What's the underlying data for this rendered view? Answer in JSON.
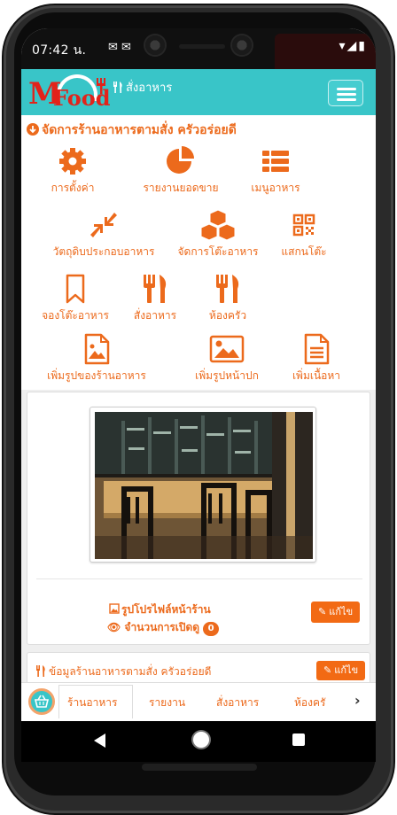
{
  "status_bar": {
    "time": "07:42 น.",
    "left_icons": "✉ ✉",
    "right_icons": "▾◢▮"
  },
  "header": {
    "logo_m": "M",
    "logo_food": "Food",
    "title": "สั่งอาหาร",
    "title_icon": "fork-knife-icon",
    "menu_icon": "hamburger-menu-icon"
  },
  "menu": {
    "heading": "จัดการร้านอาหารตามสั่ง ครัวอร่อยดี",
    "heading_icon": "circle-arrow-down-icon",
    "items": [
      {
        "label": "การตั้งค่า",
        "icon": "gear-icon"
      },
      {
        "label": "รายงานยอดขาย",
        "icon": "pie-chart-icon"
      },
      {
        "label": "เมนูอาหาร",
        "icon": "list-icon"
      },
      {
        "label": "วัตถุดิบประกอบอาหาร",
        "icon": "compress-arrows-icon"
      },
      {
        "label": "จัดการโต๊ะอาหาร",
        "icon": "cubes-icon"
      },
      {
        "label": "แสกนโต๊ะ",
        "icon": "qr-code-icon"
      },
      {
        "label": "จองโต๊ะอาหาร",
        "icon": "bookmark-icon"
      },
      {
        "label": "สั่งอาหาร",
        "icon": "fork-knife-icon"
      },
      {
        "label": "ห้องครัว",
        "icon": "fork-knife-icon"
      },
      {
        "label": "เพิ่มรูปของร้านอาหาร",
        "icon": "image-file-icon"
      },
      {
        "label": "เพิ่มรูปหน้าปก",
        "icon": "image-icon"
      },
      {
        "label": "เพิ่มเนื้อหา",
        "icon": "text-file-icon"
      }
    ]
  },
  "profile_card": {
    "photo_alt": "restaurant-interior-photo",
    "profile_label": "รูปโปรไฟล์หน้าร้าน",
    "views_label": "จำนวนการเปิดดู",
    "views_count": "0",
    "edit_label": "แก้ไข"
  },
  "info_card": {
    "title": "ข้อมูลร้านอาหารตามสั่ง ครัวอร่อยดี",
    "edit_label": "แก้ไข"
  },
  "tabs": {
    "items": [
      "ร้านอาหาร",
      "รายงาน",
      "สั่งอาหาร",
      "ห้องครั"
    ],
    "next_icon": "chevron-right-icon"
  },
  "colors": {
    "primary": "#39c5c8",
    "accent": "#ec6a1c",
    "logo_red": "#e2231a"
  }
}
